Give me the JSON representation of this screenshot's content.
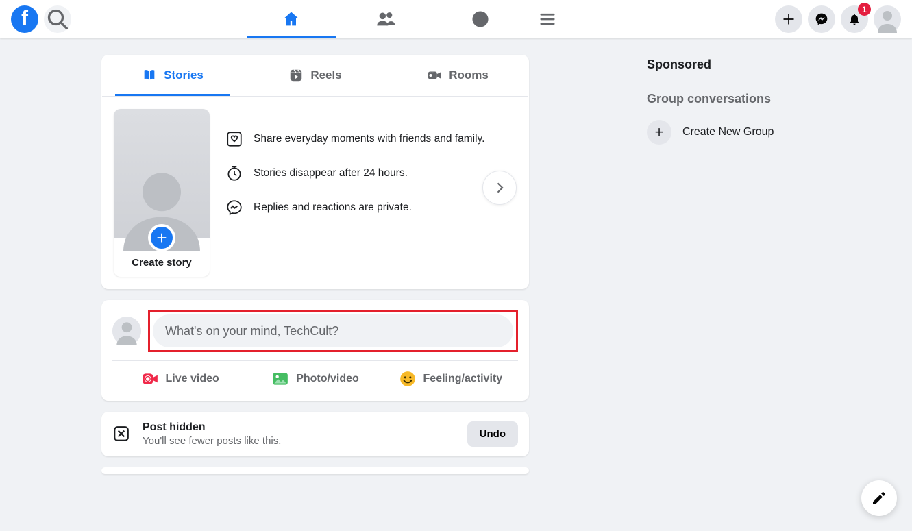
{
  "notification_count": "1",
  "tabs": {
    "stories": "Stories",
    "reels": "Reels",
    "rooms": "Rooms"
  },
  "story_create_label": "Create story",
  "story_bullets": [
    "Share everyday moments with friends and family.",
    "Stories disappear after 24 hours.",
    "Replies and reactions are private."
  ],
  "compose_placeholder": "What's on your mind, TechCult?",
  "compose_actions": {
    "live": "Live video",
    "photo": "Photo/video",
    "feeling": "Feeling/activity"
  },
  "hidden": {
    "title": "Post hidden",
    "subtitle": "You'll see fewer posts like this.",
    "undo": "Undo"
  },
  "right": {
    "sponsored": "Sponsored",
    "group_conversations": "Group conversations",
    "create_group": "Create New Group"
  }
}
